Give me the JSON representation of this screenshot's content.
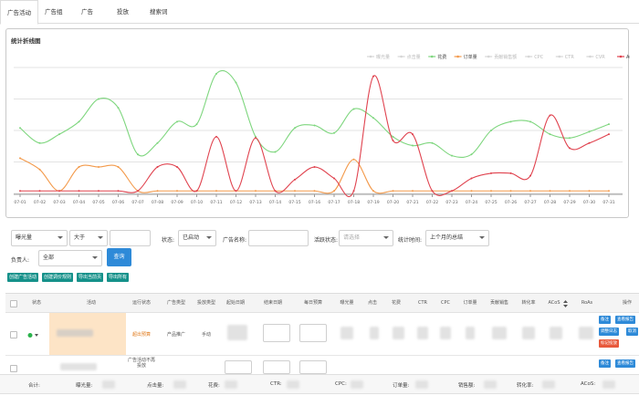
{
  "tabs": [
    "广告活动",
    "广告组",
    "广告",
    "投放",
    "搜索词"
  ],
  "active_tab": 0,
  "chart_title": "统计折线图",
  "chart_data": {
    "type": "line",
    "x": [
      "07-01",
      "07-02",
      "07-03",
      "07-04",
      "07-05",
      "07-06",
      "07-07",
      "07-08",
      "07-09",
      "07-10",
      "07-11",
      "07-12",
      "07-13",
      "07-14",
      "07-15",
      "07-16",
      "07-17",
      "07-18",
      "07-19",
      "07-20",
      "07-21",
      "07-22",
      "07-23",
      "07-24",
      "07-25",
      "07-26",
      "07-27",
      "07-28",
      "07-29",
      "07-30",
      "07-31"
    ],
    "legend": [
      "曝光量",
      "点击量",
      "花费",
      "订单量",
      "贡献销售额",
      "CPC",
      "CTR",
      "CVR",
      "ACoS"
    ],
    "legend_colors": [
      "#d0d0d0",
      "#d0d0d0",
      "#7ed67e",
      "#f39a4b",
      "#d0d0d0",
      "#d0d0d0",
      "#d0d0d0",
      "#d0d0d0",
      "#e0434f"
    ],
    "legend_active": [
      false,
      false,
      true,
      true,
      false,
      false,
      false,
      false,
      true
    ],
    "legend_position": "top-right",
    "grid": true,
    "ylim": [
      0,
      100
    ],
    "series": [
      {
        "name": "花费",
        "color": "#7ed67e",
        "values": [
          52,
          40,
          47,
          57,
          75,
          68,
          31,
          40,
          57,
          55,
          95,
          88,
          45,
          33,
          52,
          54,
          48,
          67,
          60,
          45,
          38,
          40,
          30,
          31,
          50,
          57,
          57,
          47,
          44,
          49,
          55
        ]
      },
      {
        "name": "订单量",
        "color": "#f39a4b",
        "values": [
          28,
          19,
          2,
          21,
          21,
          21,
          2,
          2,
          2,
          2,
          2,
          2,
          2,
          2,
          2,
          2,
          2,
          27,
          2,
          2,
          2,
          2,
          2,
          2,
          2,
          2,
          2,
          2,
          2,
          2,
          2
        ]
      },
      {
        "name": "ACoS",
        "color": "#e0434f",
        "values": [
          2,
          2,
          2,
          2,
          2,
          2,
          2,
          21,
          21,
          2,
          45,
          2,
          44,
          2,
          11,
          21,
          12,
          2,
          93,
          42,
          47,
          2,
          2,
          12,
          16,
          16,
          14,
          62,
          36,
          40,
          47
        ]
      }
    ]
  },
  "filters": {
    "metric1": "曝光量",
    "op1": "大于",
    "val1": "",
    "status_label": "状态:",
    "status_value": "已启动",
    "name_label": "广告名称:",
    "name_value": "",
    "activity_label": "活跃状态:",
    "activity_placeholder": "请选择",
    "period_label": "统计时间:",
    "period_value": "上个月的总结",
    "owner_label": "负责人:",
    "owner_value": "全部",
    "query_button": "查询"
  },
  "actions": [
    "创建广告活动",
    "创建调价规则",
    "导出当前页",
    "导出所有"
  ],
  "table": {
    "headers": [
      "状态",
      "活动",
      "运行状态",
      "广告类型",
      "投放类型",
      "起始日期",
      "结束日期",
      "每日预算",
      "曝光量",
      "点击",
      "花费",
      "CTR",
      "CPC",
      "订单量",
      "贡献销售",
      "转化率",
      "ACoS",
      "RoAs",
      "操作"
    ],
    "row1": {
      "run_status": "超出预算",
      "ad_type": "产品推广",
      "targeting": "手动",
      "ops": [
        "备注",
        "查看报告",
        "调整日志",
        "取消",
        "标记投放"
      ]
    },
    "row2": {
      "run_status": "广告活动不再投放",
      "ops": [
        "备注",
        "查看报告"
      ]
    }
  },
  "footer": {
    "total": "合计:",
    "impr": "曝光量:",
    "clicks": "点击量:",
    "spend": "花费:",
    "ctr": "CTR:",
    "cpc": "CPC:",
    "orders": "订单量:",
    "sales": "销售额:",
    "cvr": "转化率:",
    "acos": "ACoS:"
  }
}
